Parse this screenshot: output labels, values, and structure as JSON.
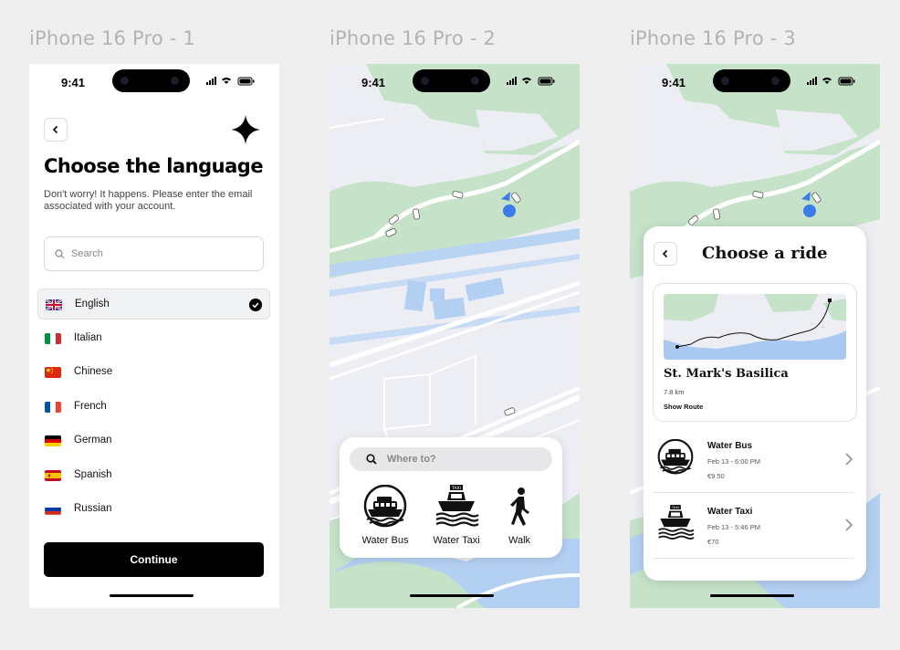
{
  "frames": [
    {
      "title": "iPhone 16 Pro - 1"
    },
    {
      "title": "iPhone 16 Pro - 2"
    },
    {
      "title": "iPhone 16 Pro - 3"
    }
  ],
  "status_bar": {
    "time": "9:41"
  },
  "language_screen": {
    "title": "Choose the language",
    "subtitle": "Don't worry! It happens. Please enter the email associated with your account.",
    "search_placeholder": "Search",
    "languages": [
      {
        "label": "English",
        "flag": "uk-flag-icon",
        "selected": true
      },
      {
        "label": "Italian",
        "flag": "italy-flag-icon",
        "selected": false
      },
      {
        "label": "Chinese",
        "flag": "china-flag-icon",
        "selected": false
      },
      {
        "label": "French",
        "flag": "france-flag-icon",
        "selected": false
      },
      {
        "label": "German",
        "flag": "germany-flag-icon",
        "selected": false
      },
      {
        "label": "Spanish",
        "flag": "spain-flag-icon",
        "selected": false
      },
      {
        "label": "Russian",
        "flag": "russia-flag-icon",
        "selected": false
      }
    ],
    "continue_label": "Continue"
  },
  "map_screen": {
    "search_placeholder": "Where to?",
    "modes": [
      {
        "label": "Water Bus",
        "icon": "water-bus-icon"
      },
      {
        "label": "Water Taxi",
        "icon": "water-taxi-icon"
      },
      {
        "label": "Walk",
        "icon": "walk-icon"
      }
    ]
  },
  "ride_screen": {
    "title": "Choose a ride",
    "destination": {
      "name": "St. Mark's Basilica",
      "distance": "7.8 km",
      "show_route_label": "Show Route"
    },
    "options": [
      {
        "name": "Water Bus",
        "time": "Feb 13 - 6:00 PM",
        "price": "€9.50",
        "icon": "water-bus-icon"
      },
      {
        "name": "Water Taxi",
        "time": "Feb 13 -  5:46 PM",
        "price": "€70",
        "icon": "water-taxi-icon"
      }
    ]
  },
  "colors": {
    "map_land": "#eceef3",
    "map_green": "#c6e2c9",
    "map_water": "#a9c9f2",
    "location_blue": "#3b7de8",
    "primary": "#000000"
  }
}
